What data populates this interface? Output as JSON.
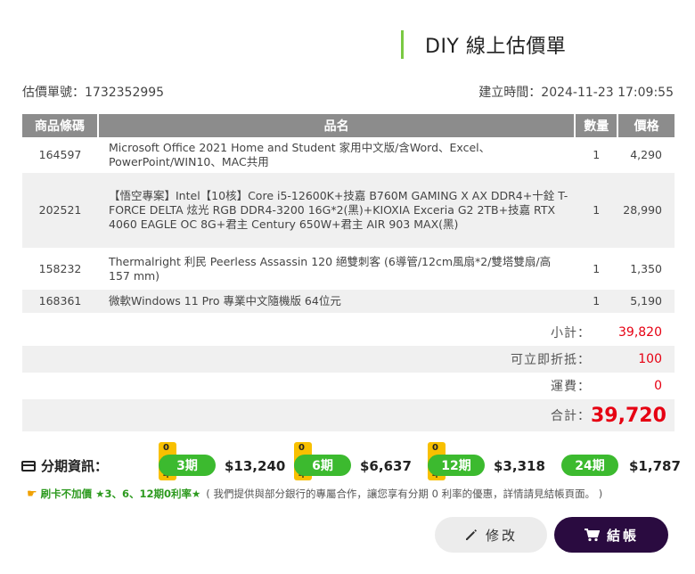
{
  "header": {
    "title": "DIY 線上估價單"
  },
  "meta": {
    "quote_no": "估價單號：1732352995",
    "created": "建立時間：2024-11-23 17:09:55"
  },
  "table": {
    "headers": [
      "商品條碼",
      "品名",
      "數量",
      "價格"
    ],
    "rows": [
      {
        "code": "164597",
        "name": "Microsoft Office 2021 Home and Student 家用中文版/含Word、Excel、PowerPoint/WIN10、MAC共用",
        "qty": "1",
        "price": "4,290"
      },
      {
        "code": "202521",
        "name": "【悟空專案】Intel【10核】Core i5-12600K+技嘉 B760M GAMING X AX DDR4+十銓 T-FORCE DELTA 炫光 RGB DDR4-3200 16G*2(黑)+KIOXIA Exceria G2 2TB+技嘉 RTX 4060 EAGLE OC 8G+君主 Century 650W+君主 AIR 903 MAX(黑)",
        "qty": "1",
        "price": "28,990"
      },
      {
        "code": "158232",
        "name": "Thermalright 利民 Peerless Assassin 120 絕雙刺客 (6導管/12cm風扇*2/雙塔雙扇/高157 mm)",
        "qty": "1",
        "price": "1,350"
      },
      {
        "code": "168361",
        "name": "微軟Windows 11 Pro 專業中文隨機版 64位元",
        "qty": "1",
        "price": "5,190"
      }
    ]
  },
  "summary": {
    "subtotal_label": "小計：",
    "subtotal": "39,820",
    "discount_label": "可立即折抵：",
    "discount": "100",
    "shipping_label": "運費：",
    "shipping": "0",
    "total_label": "合計：",
    "total": "39,720"
  },
  "installments": {
    "title": "分期資訊：",
    "plans": [
      {
        "badge": "0利率",
        "term": "3期",
        "amount": "$13,240"
      },
      {
        "badge": "0利率",
        "term": "6期",
        "amount": "$6,637"
      },
      {
        "badge": "0利率",
        "term": "12期",
        "amount": "$3,318"
      },
      {
        "term": "24期",
        "amount": "$1,787"
      }
    ],
    "note_highlight": "刷卡不加價 ★3、6、12期0利率★",
    "note_text": "( 我們提供與部分銀行的專屬合作，讓您享有分期 0 利率的優惠，詳情請見結帳頁面。 )"
  },
  "buttons": {
    "edit": "修改",
    "checkout": "結帳"
  },
  "colors": {
    "accent_green": "#3cba2f",
    "price_red": "#e60012",
    "checkout_bg": "#2a0b40",
    "badge_yellow": "#f8c000"
  }
}
